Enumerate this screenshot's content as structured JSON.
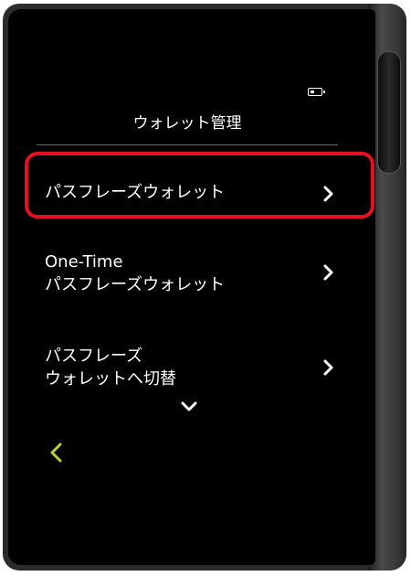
{
  "header": {
    "title": "ウォレット管理"
  },
  "status": {
    "battery_icon": "battery-icon"
  },
  "menu": {
    "items": [
      {
        "label": "パスフレーズウォレット",
        "icon": "chevron-right-icon",
        "selected": true
      },
      {
        "label_line1": "One-Time",
        "label_line2": "パスフレーズウォレット",
        "icon": "chevron-right-icon"
      },
      {
        "label_line1": "パスフレーズ",
        "label_line2": "ウォレットへ切替",
        "icon": "chevron-right-icon"
      }
    ]
  },
  "nav": {
    "scroll_down_icon": "chevron-down-icon",
    "back_icon": "chevron-left-icon"
  },
  "colors": {
    "highlight": "#e8101e",
    "back_accent": "#b8d432",
    "background": "#000000",
    "text": "#ffffff"
  }
}
